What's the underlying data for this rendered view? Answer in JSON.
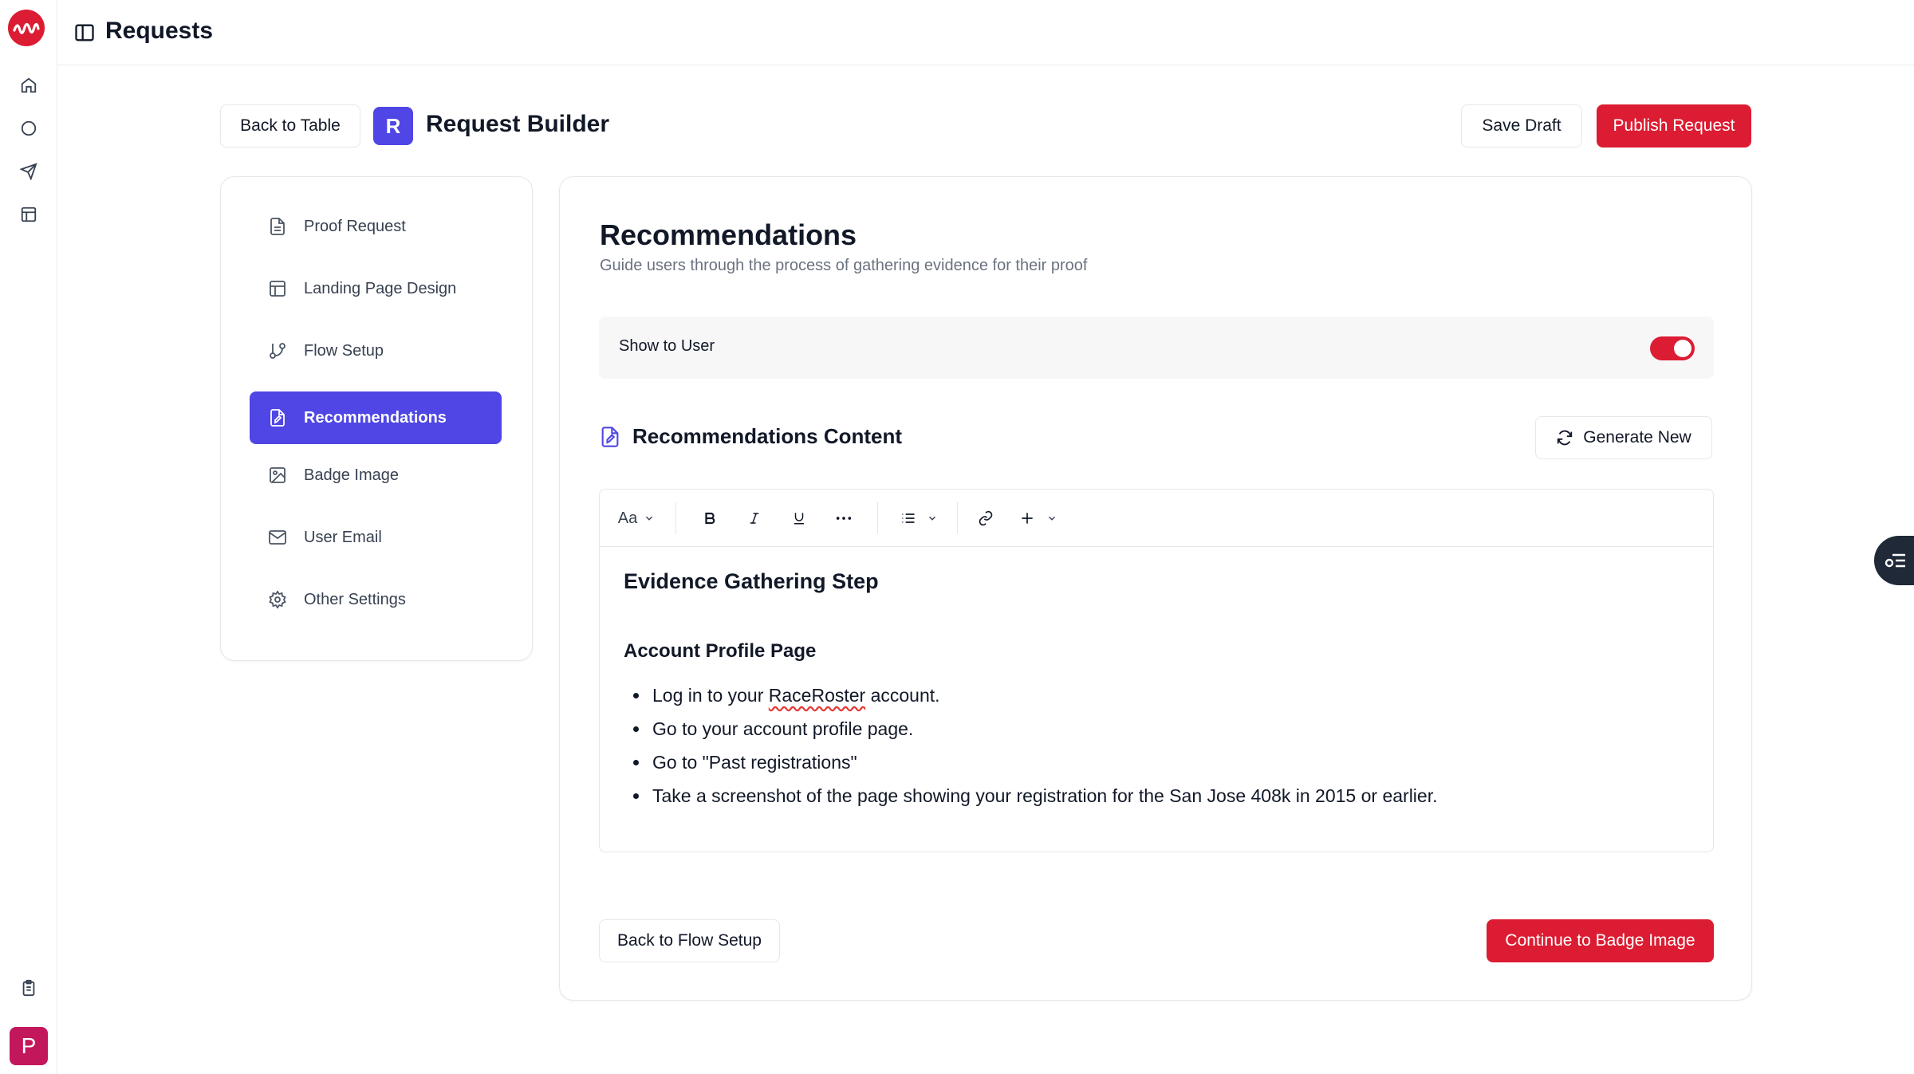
{
  "header": {
    "title": "Requests"
  },
  "builder": {
    "back_label": "Back to Table",
    "badge_letter": "R",
    "title": "Request Builder",
    "save_label": "Save Draft",
    "publish_label": "Publish Request"
  },
  "steps": [
    {
      "label": "Proof Request",
      "icon": "document-icon"
    },
    {
      "label": "Landing Page Design",
      "icon": "layout-icon"
    },
    {
      "label": "Flow Setup",
      "icon": "git-branch-icon"
    },
    {
      "label": "Recommendations",
      "icon": "file-edit-icon",
      "active": true
    },
    {
      "label": "Badge Image",
      "icon": "image-icon"
    },
    {
      "label": "User Email",
      "icon": "mail-icon"
    },
    {
      "label": "Other Settings",
      "icon": "gear-icon"
    }
  ],
  "section": {
    "title": "Recommendations",
    "subtitle": "Guide users through the process of gathering evidence for their proof",
    "show_label": "Show to User",
    "show_enabled": true,
    "content_title": "Recommendations Content",
    "generate_label": "Generate New"
  },
  "toolbar": {
    "font_label": "Aa"
  },
  "editor": {
    "heading": "Evidence Gathering Step",
    "subheading": "Account Profile Page",
    "item1_pre": "Log in to your ",
    "item1_word": "RaceRoster",
    "item1_post": " account.",
    "item2": "Go to your account profile page.",
    "item3": "Go to \"Past registrations\"",
    "item4": "Take a screenshot of the page showing your registration for the San Jose 408k in 2015 or earlier."
  },
  "footer": {
    "back_label": "Back to Flow Setup",
    "continue_label": "Continue to Badge Image"
  },
  "user": {
    "avatar_letter": "P"
  },
  "colors": {
    "brand": "#dc1c32",
    "accent": "#4f46e5"
  }
}
